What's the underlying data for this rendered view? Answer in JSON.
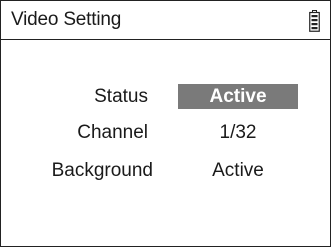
{
  "header": {
    "title": "Video Setting",
    "battery_icon": "battery-icon"
  },
  "settings": [
    {
      "label": "Status",
      "value": "Active",
      "selected": true
    },
    {
      "label": "Channel",
      "value": "1/32",
      "selected": false
    },
    {
      "label": "Background",
      "value": "Active",
      "selected": false
    }
  ],
  "colors": {
    "selection_bg": "#7a7a7a",
    "selection_text": "#ffffff",
    "border": "#222222"
  }
}
